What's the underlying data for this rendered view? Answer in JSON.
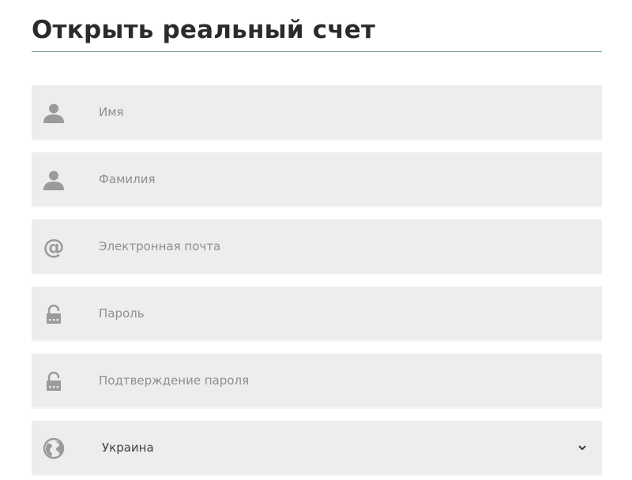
{
  "page": {
    "title": "Открыть реальный счет"
  },
  "form": {
    "first_name": {
      "placeholder": "Имя",
      "icon": "user-icon"
    },
    "last_name": {
      "placeholder": "Фамилия",
      "icon": "user-icon"
    },
    "email": {
      "placeholder": "Электронная почта",
      "icon": "at-sign-icon"
    },
    "password": {
      "placeholder": "Пароль",
      "icon": "lock-icon"
    },
    "password_confirm": {
      "placeholder": "Подтверждение пароля",
      "icon": "lock-icon"
    },
    "country": {
      "selected": "Украина",
      "icon": "globe-icon"
    }
  },
  "colors": {
    "accent_rule": "#6a9a79",
    "field_bg": "#eeeded",
    "icon": "#9a9a9a",
    "title": "#2b2b2b"
  }
}
